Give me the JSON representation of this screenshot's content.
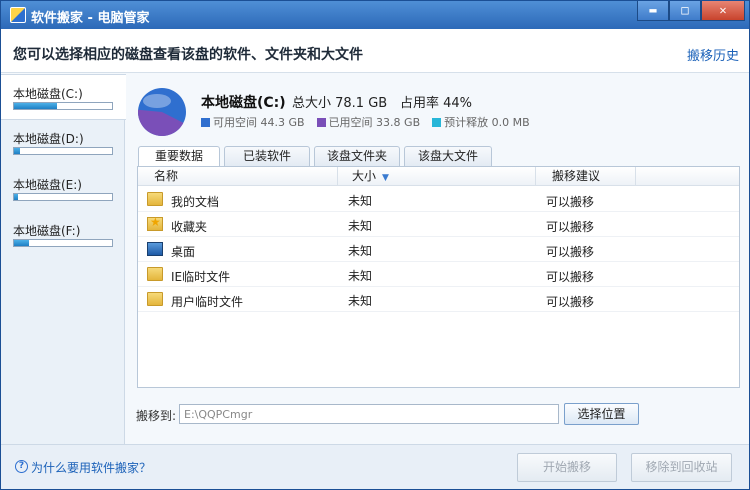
{
  "window": {
    "title": "软件搬家 - 电脑管家",
    "controls": {
      "minimize": "▬",
      "maximize": "□",
      "close": "✕"
    }
  },
  "header": {
    "text": "您可以选择相应的磁盘查看该盘的软件、文件夹和大文件",
    "history_link": "搬移历史"
  },
  "sidebar": {
    "disks": [
      {
        "label": "本地磁盘(C:)",
        "usage": 0.44,
        "active": true
      },
      {
        "label": "本地磁盘(D:)",
        "usage": 0.06,
        "active": false
      },
      {
        "label": "本地磁盘(E:)",
        "usage": 0.04,
        "active": false
      },
      {
        "label": "本地磁盘(F:)",
        "usage": 0.15,
        "active": false
      }
    ]
  },
  "disk_info": {
    "name": "本地磁盘(C:)",
    "total": "总大小 78.1 GB",
    "usage_rate": "占用率 44%",
    "usage_fraction": 0.44,
    "legend": [
      {
        "label": "可用空间 44.3 GB",
        "color": "#2f6fcf"
      },
      {
        "label": "已用空间 33.8 GB",
        "color": "#7a4fb8"
      },
      {
        "label": "预计释放 0.0 MB",
        "color": "#27b6d8"
      }
    ]
  },
  "tabs": [
    {
      "label": "重要数据",
      "active": true
    },
    {
      "label": "已装软件",
      "active": false
    },
    {
      "label": "该盘文件夹",
      "active": false
    },
    {
      "label": "该盘大文件",
      "active": false
    }
  ],
  "table": {
    "columns": {
      "name": "名称",
      "size": "大小",
      "advice": "搬移建议"
    },
    "rows": [
      {
        "icon": "folder-icon",
        "name": "我的文档",
        "size": "未知",
        "advice": "可以搬移"
      },
      {
        "icon": "favorites-icon",
        "name": "收藏夹",
        "size": "未知",
        "advice": "可以搬移"
      },
      {
        "icon": "desktop-icon",
        "name": "桌面",
        "size": "未知",
        "advice": "可以搬移"
      },
      {
        "icon": "folder-icon",
        "name": "IE临时文件",
        "size": "未知",
        "advice": "可以搬移"
      },
      {
        "icon": "folder-icon",
        "name": "用户临时文件",
        "size": "未知",
        "advice": "可以搬移"
      }
    ]
  },
  "target": {
    "label": "搬移到:",
    "value": "E:\\QQPCmgr",
    "choose_button": "选择位置"
  },
  "footer": {
    "help_icon": "?",
    "help_link": "为什么要用软件搬家？",
    "start_button": "开始搬移",
    "recycle_button": "移除到回收站"
  },
  "colors": {
    "accent": "#2d6fd0",
    "link": "#1c62b9",
    "titlebar": "#3a78c4",
    "pie_free": "#2f6fcf",
    "pie_used": "#7a4fb8"
  }
}
